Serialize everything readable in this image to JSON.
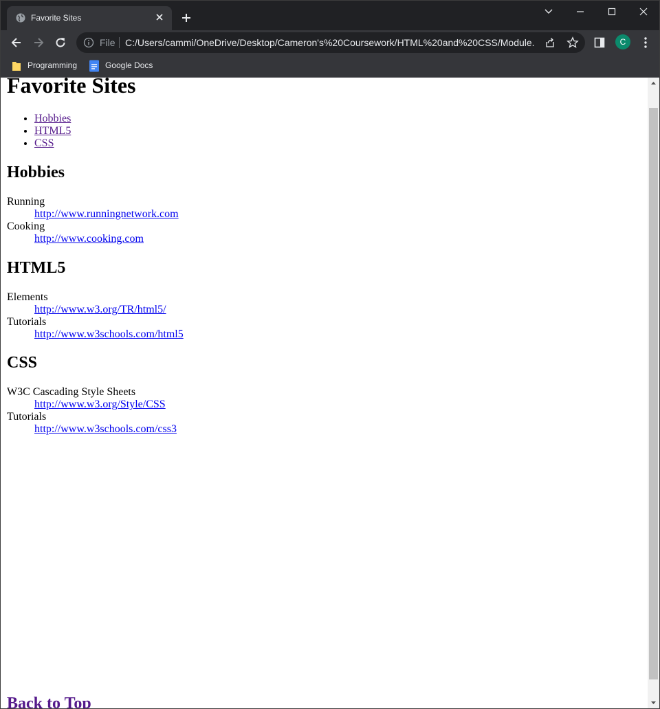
{
  "browser": {
    "tab_title": "Favorite Sites",
    "address": {
      "security_label": "File",
      "url": "C:/Users/cammi/OneDrive/Desktop/Cameron's%20Coursework/HTML%20and%20CSS/Module..."
    },
    "profile_initial": "C",
    "bookmarks": [
      {
        "label": "Programming",
        "icon": "folder-icon"
      },
      {
        "label": "Google Docs",
        "icon": "google-docs-icon"
      }
    ],
    "colors": {
      "frame": "#202124",
      "toolbar": "#35363a",
      "avatar": "#0b8a6c"
    }
  },
  "page": {
    "title": "Favorite Sites",
    "toc": [
      "Hobbies",
      "HTML5",
      "CSS"
    ],
    "sections": [
      {
        "heading": "Hobbies",
        "items": [
          {
            "term": "Running",
            "link": "http://www.runningnetwork.com"
          },
          {
            "term": "Cooking",
            "link": "http://www.cooking.com"
          }
        ]
      },
      {
        "heading": "HTML5",
        "items": [
          {
            "term": "Elements",
            "link": "http://www.w3.org/TR/html5/"
          },
          {
            "term": "Tutorials",
            "link": "http://www.w3schools.com/html5"
          }
        ]
      },
      {
        "heading": "CSS",
        "items": [
          {
            "term": "W3C Cascading Style Sheets",
            "link": "http://www.w3.org/Style/CSS"
          },
          {
            "term": "Tutorials",
            "link": "http://www.w3schools.com/css3"
          }
        ]
      }
    ],
    "back_to_top": "Back to Top",
    "colors": {
      "visited_link": "#551a8b",
      "link": "#0000ee"
    }
  }
}
